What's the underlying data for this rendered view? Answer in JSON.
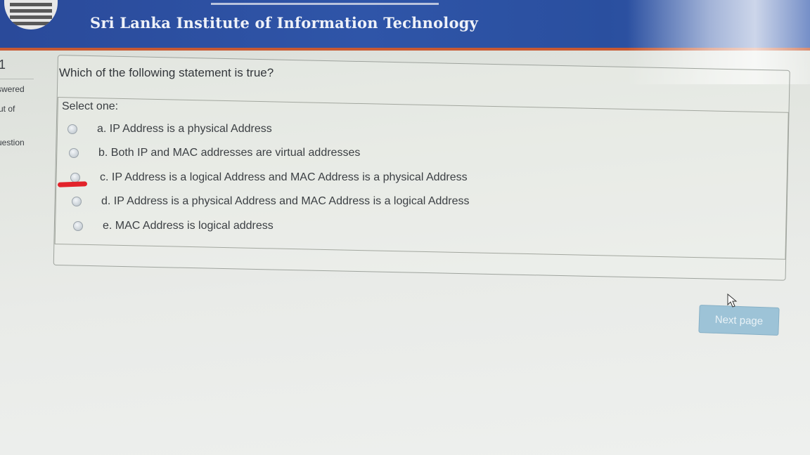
{
  "header": {
    "institution": "Sri Lanka Institute of Information Technology"
  },
  "sidebar_info": {
    "question_number": "1",
    "status": "swered",
    "marks": "ut of",
    "flag": "uestion"
  },
  "question": {
    "text": "Which of the following statement is true?",
    "prompt": "Select one:",
    "options": [
      {
        "label": "a. IP Address is a physical Address"
      },
      {
        "label": "b. Both IP and MAC addresses are virtual addresses"
      },
      {
        "label": "c. IP Address is a logical Address and MAC Address is a physical Address"
      },
      {
        "label": "d. IP Address is a physical Address and MAC Address is a logical Address"
      },
      {
        "label": "e. MAC Address is logical address"
      }
    ]
  },
  "navigation": {
    "next_label": "Next page"
  },
  "colors": {
    "header_blue": "#2f55a8",
    "header_accent": "#c85a33",
    "button": "#9dc3d7",
    "mark_red": "#e2222a"
  },
  "icons": {
    "logo": "institute-logo",
    "radio": "radio-button",
    "cursor": "mouse-pointer-icon"
  }
}
